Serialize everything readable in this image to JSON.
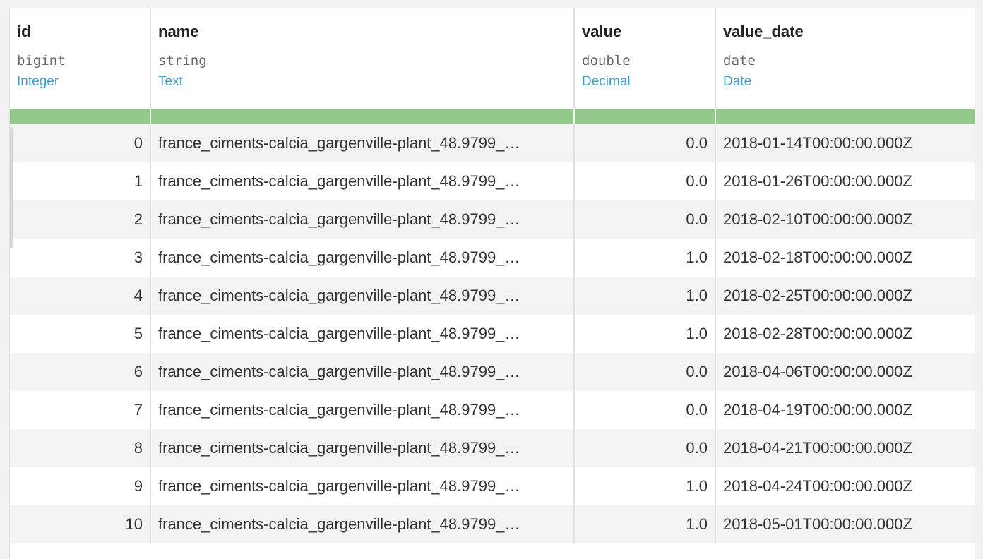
{
  "columns": [
    {
      "name": "id",
      "storage_type": "bigint",
      "meaning": "Integer"
    },
    {
      "name": "name",
      "storage_type": "string",
      "meaning": "Text"
    },
    {
      "name": "value",
      "storage_type": "double",
      "meaning": "Decimal"
    },
    {
      "name": "value_date",
      "storage_type": "date",
      "meaning": "Date"
    }
  ],
  "quality_bar_color": "#94c78c",
  "meaning_color": "#3d9fd3",
  "rows": [
    {
      "id": "0",
      "name": "france_ciments-calcia_gargenville-plant_48.9799_…",
      "value": "0.0",
      "value_date": "2018-01-14T00:00:00.000Z"
    },
    {
      "id": "1",
      "name": "france_ciments-calcia_gargenville-plant_48.9799_…",
      "value": "0.0",
      "value_date": "2018-01-26T00:00:00.000Z"
    },
    {
      "id": "2",
      "name": "france_ciments-calcia_gargenville-plant_48.9799_…",
      "value": "0.0",
      "value_date": "2018-02-10T00:00:00.000Z"
    },
    {
      "id": "3",
      "name": "france_ciments-calcia_gargenville-plant_48.9799_…",
      "value": "1.0",
      "value_date": "2018-02-18T00:00:00.000Z"
    },
    {
      "id": "4",
      "name": "france_ciments-calcia_gargenville-plant_48.9799_…",
      "value": "1.0",
      "value_date": "2018-02-25T00:00:00.000Z"
    },
    {
      "id": "5",
      "name": "france_ciments-calcia_gargenville-plant_48.9799_…",
      "value": "1.0",
      "value_date": "2018-02-28T00:00:00.000Z"
    },
    {
      "id": "6",
      "name": "france_ciments-calcia_gargenville-plant_48.9799_…",
      "value": "0.0",
      "value_date": "2018-04-06T00:00:00.000Z"
    },
    {
      "id": "7",
      "name": "france_ciments-calcia_gargenville-plant_48.9799_…",
      "value": "0.0",
      "value_date": "2018-04-19T00:00:00.000Z"
    },
    {
      "id": "8",
      "name": "france_ciments-calcia_gargenville-plant_48.9799_…",
      "value": "0.0",
      "value_date": "2018-04-21T00:00:00.000Z"
    },
    {
      "id": "9",
      "name": "france_ciments-calcia_gargenville-plant_48.9799_…",
      "value": "1.0",
      "value_date": "2018-04-24T00:00:00.000Z"
    },
    {
      "id": "10",
      "name": "france_ciments-calcia_gargenville-plant_48.9799_…",
      "value": "1.0",
      "value_date": "2018-05-01T00:00:00.000Z"
    }
  ]
}
